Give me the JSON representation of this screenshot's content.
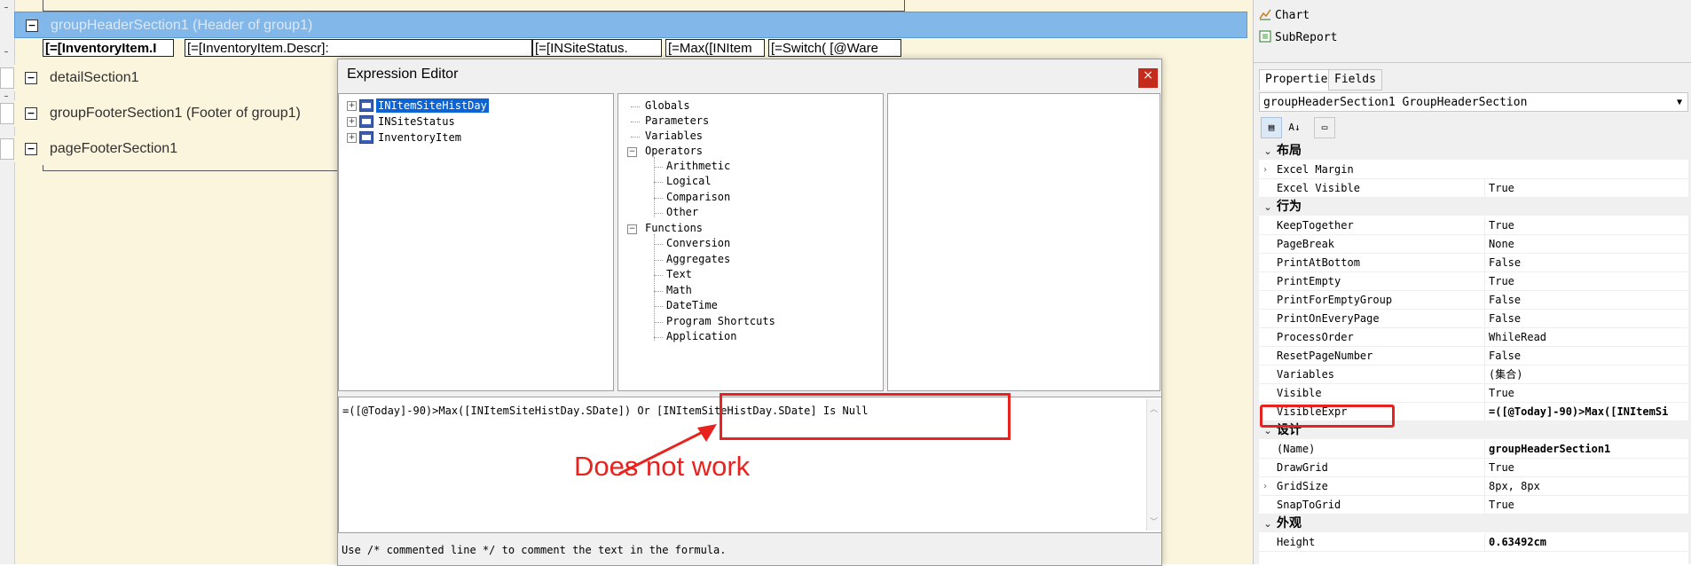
{
  "designer": {
    "sections": [
      {
        "label": "groupHeaderSection1 (Header of group1)",
        "selected": true
      },
      {
        "label": "detailSection1",
        "selected": false
      },
      {
        "label": "groupFooterSection1 (Footer of group1)",
        "selected": false
      },
      {
        "label": "pageFooterSection1",
        "selected": false
      }
    ],
    "toggle_glyph": "⊟",
    "cells": [
      "[=[InventoryItem.I",
      "[=[InventoryItem.Descr]:",
      "[=[INSiteStatus.",
      "[=Max([INItem",
      "[=Switch( [@Ware"
    ]
  },
  "dialog": {
    "title": "Expression Editor",
    "close_glyph": "×",
    "tables": [
      "INItemSiteHistDay",
      "INSiteStatus",
      "InventoryItem"
    ],
    "functions": {
      "globals": "Globals",
      "parameters": "Parameters",
      "variables": "Variables",
      "operators": "Operators",
      "operator_items": [
        "Arithmetic",
        "Logical",
        "Comparison",
        "Other"
      ],
      "functions": "Functions",
      "function_items": [
        "Conversion",
        "Aggregates",
        "Text",
        "Math",
        "DateTime",
        "Program Shortcuts",
        "Application"
      ]
    },
    "formula": "=([@Today]-90)>Max([INItemSiteHistDay.SDate]) Or [INItemSiteHistDay.SDate] Is Null",
    "hint": "Use /* commented line */ to comment the text in the formula."
  },
  "annotation": {
    "text": "Does not work",
    "color": "#e8231f"
  },
  "right_panel": {
    "toolbox": [
      "Chart",
      "SubReport"
    ],
    "tabs": [
      "Properties",
      "Fields"
    ],
    "object": "groupHeaderSection1  GroupHeaderSection",
    "categories": [
      {
        "name": "布局",
        "props": [
          {
            "name": "Excel Margin",
            "value": "",
            "expandable": true
          },
          {
            "name": "Excel Visible",
            "value": "True"
          }
        ]
      },
      {
        "name": "行为",
        "props": [
          {
            "name": "KeepTogether",
            "value": "True"
          },
          {
            "name": "PageBreak",
            "value": "None"
          },
          {
            "name": "PrintAtBottom",
            "value": "False"
          },
          {
            "name": "PrintEmpty",
            "value": "True"
          },
          {
            "name": "PrintForEmptyGroup",
            "value": "False"
          },
          {
            "name": "PrintOnEveryPage",
            "value": "False"
          },
          {
            "name": "ProcessOrder",
            "value": "WhileRead"
          },
          {
            "name": "ResetPageNumber",
            "value": "False"
          },
          {
            "name": "Variables",
            "value": "(集合)"
          },
          {
            "name": "Visible",
            "value": "True"
          },
          {
            "name": "VisibleExpr",
            "value": "=([@Today]-90)>Max([INItemSi",
            "bold": true
          }
        ]
      },
      {
        "name": "设计",
        "props": [
          {
            "name": "(Name)",
            "value": "groupHeaderSection1",
            "bold": true
          },
          {
            "name": "DrawGrid",
            "value": "True"
          },
          {
            "name": "GridSize",
            "value": "8px, 8px",
            "expandable": true
          },
          {
            "name": "SnapToGrid",
            "value": "True"
          }
        ]
      },
      {
        "name": "外观",
        "props": [
          {
            "name": "Height",
            "value": "0.63492cm",
            "bold": true
          }
        ]
      }
    ]
  }
}
